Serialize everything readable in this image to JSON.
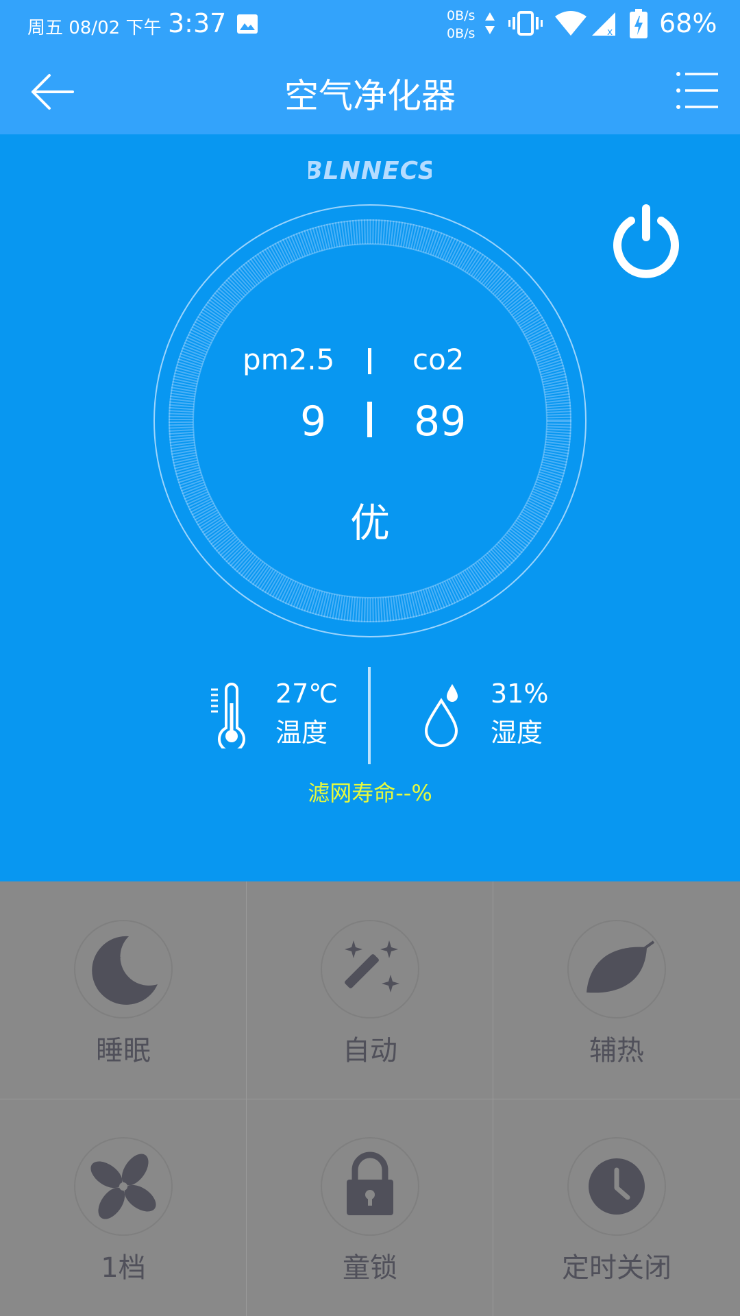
{
  "status_bar": {
    "date": "周五 08/02 下午",
    "time": "3:37",
    "net_up": "0B/s",
    "net_down": "0B/s",
    "battery": "68%"
  },
  "app_bar": {
    "title": "空气净化器",
    "back_icon": "arrow-left-icon",
    "menu_icon": "menu-list-icon"
  },
  "brand": "BLNNECS",
  "metrics": {
    "pm25_label": "pm2.5",
    "co2_label": "co2",
    "pm25_value": "9",
    "co2_value": "89",
    "quality": "优"
  },
  "environment": {
    "temperature": "27℃",
    "temperature_label": "温度",
    "humidity": "31%",
    "humidity_label": "湿度"
  },
  "filter_life": "滤网寿命--%",
  "colors": {
    "status_bar": "#33a3fb",
    "main_bg": "#0897f1",
    "filter_text": "#e8fa3c",
    "grid_bg": "#898989",
    "grid_label": "#50505a"
  },
  "modes": [
    {
      "label": "睡眠",
      "icon": "moon-icon"
    },
    {
      "label": "自动",
      "icon": "magic-wand-icon"
    },
    {
      "label": "辅热",
      "icon": "leaf-icon"
    },
    {
      "label": "1档",
      "icon": "fan-icon"
    },
    {
      "label": "童锁",
      "icon": "lock-icon"
    },
    {
      "label": "定时关闭",
      "icon": "clock-icon"
    }
  ]
}
